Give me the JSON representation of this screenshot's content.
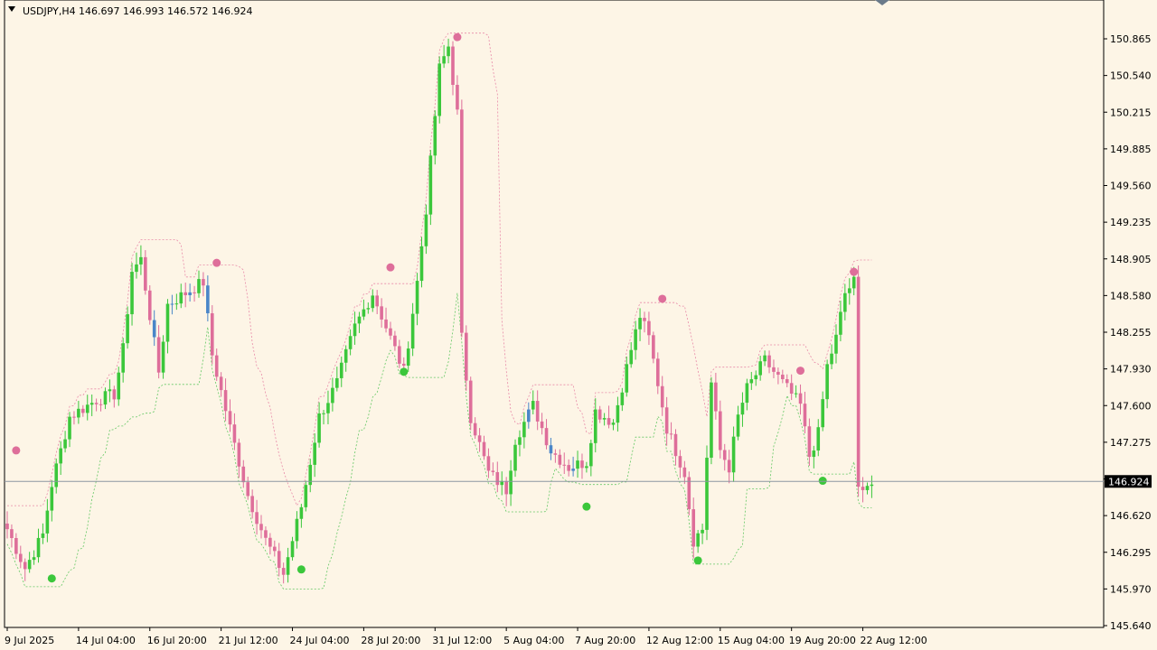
{
  "header": {
    "symbol": "USDJPY,H4",
    "ohlc": "146.697 146.993 146.572 146.924",
    "menu_icon": "triangle-down-icon"
  },
  "colors": {
    "background": "#fdf5e6",
    "bull": "#3bc73b",
    "bear": "#de6e9a",
    "neutral": "#4a86c8",
    "band_upper": "#e88aa8",
    "band_lower": "#64c864",
    "price_line": "#8c96a0",
    "axis": "#000000"
  },
  "chart_data": {
    "type": "candlestick",
    "symbol": "USDJPY",
    "timeframe": "H4",
    "current_price": "146.924",
    "ylim": [
      145.64,
      151.03
    ],
    "y_ticks": [
      "150.865",
      "150.540",
      "150.215",
      "149.885",
      "149.560",
      "149.235",
      "148.905",
      "148.580",
      "148.255",
      "147.930",
      "147.600",
      "147.275",
      "146.950",
      "146.620",
      "146.295",
      "145.970",
      "145.640"
    ],
    "x_ticks": [
      "9 Jul 2025",
      "14 Jul 04:00",
      "16 Jul 20:00",
      "21 Jul 12:00",
      "24 Jul 04:00",
      "28 Jul 20:00",
      "31 Jul 12:00",
      "5 Aug 04:00",
      "7 Aug 20:00",
      "12 Aug 12:00",
      "15 Aug 04:00",
      "19 Aug 20:00",
      "22 Aug 12:00"
    ],
    "x_tick_index": [
      0,
      16,
      32,
      48,
      64,
      80,
      96,
      112,
      128,
      144,
      160,
      176,
      192
    ],
    "bar_count": 195,
    "anchors": [
      [
        0,
        146.5
      ],
      [
        4,
        146.15
      ],
      [
        8,
        146.45
      ],
      [
        10,
        146.9
      ],
      [
        14,
        147.5
      ],
      [
        20,
        147.65
      ],
      [
        24,
        147.7
      ],
      [
        26,
        148.1
      ],
      [
        28,
        148.8
      ],
      [
        30,
        148.9
      ],
      [
        32,
        148.4
      ],
      [
        34,
        147.9
      ],
      [
        36,
        148.5
      ],
      [
        40,
        148.6
      ],
      [
        44,
        148.7
      ],
      [
        46,
        148.05
      ],
      [
        50,
        147.4
      ],
      [
        54,
        146.8
      ],
      [
        58,
        146.4
      ],
      [
        62,
        146.1
      ],
      [
        66,
        146.7
      ],
      [
        70,
        147.5
      ],
      [
        74,
        147.8
      ],
      [
        78,
        148.3
      ],
      [
        82,
        148.6
      ],
      [
        86,
        148.2
      ],
      [
        89,
        147.9
      ],
      [
        92,
        148.7
      ],
      [
        94,
        149.35
      ],
      [
        97,
        150.6
      ],
      [
        99,
        150.8
      ],
      [
        101,
        150.2
      ],
      [
        102,
        148.2
      ],
      [
        104,
        147.5
      ],
      [
        108,
        147.0
      ],
      [
        112,
        146.85
      ],
      [
        114,
        147.3
      ],
      [
        118,
        147.6
      ],
      [
        122,
        147.2
      ],
      [
        126,
        147.05
      ],
      [
        130,
        147.1
      ],
      [
        132,
        147.55
      ],
      [
        136,
        147.45
      ],
      [
        140,
        148.1
      ],
      [
        142,
        148.4
      ],
      [
        144,
        148.2
      ],
      [
        146,
        147.8
      ],
      [
        148,
        147.4
      ],
      [
        152,
        147.0
      ],
      [
        154,
        146.4
      ],
      [
        156,
        146.5
      ],
      [
        158,
        147.8
      ],
      [
        160,
        147.2
      ],
      [
        162,
        147.05
      ],
      [
        164,
        147.5
      ],
      [
        166,
        147.75
      ],
      [
        170,
        148.0
      ],
      [
        174,
        147.8
      ],
      [
        178,
        147.6
      ],
      [
        180,
        147.15
      ],
      [
        182,
        147.35
      ],
      [
        184,
        147.95
      ],
      [
        186,
        148.2
      ],
      [
        188,
        148.6
      ],
      [
        190,
        148.7
      ],
      [
        191,
        146.85
      ],
      [
        192,
        146.9
      ]
    ],
    "signals": [
      {
        "bar": 2,
        "price": 147.2,
        "type": "sell"
      },
      {
        "bar": 10,
        "price": 146.06,
        "type": "buy"
      },
      {
        "bar": 47,
        "price": 148.87,
        "type": "sell"
      },
      {
        "bar": 66,
        "price": 146.14,
        "type": "buy"
      },
      {
        "bar": 86,
        "price": 148.83,
        "type": "sell"
      },
      {
        "bar": 89,
        "price": 147.9,
        "type": "buy"
      },
      {
        "bar": 101,
        "price": 150.88,
        "type": "sell"
      },
      {
        "bar": 130,
        "price": 146.7,
        "type": "buy"
      },
      {
        "bar": 147,
        "price": 148.55,
        "type": "sell"
      },
      {
        "bar": 155,
        "price": 146.22,
        "type": "buy"
      },
      {
        "bar": 178,
        "price": 147.91,
        "type": "sell"
      },
      {
        "bar": 183,
        "price": 146.93,
        "type": "buy"
      },
      {
        "bar": 190,
        "price": 148.79,
        "type": "sell"
      }
    ]
  }
}
